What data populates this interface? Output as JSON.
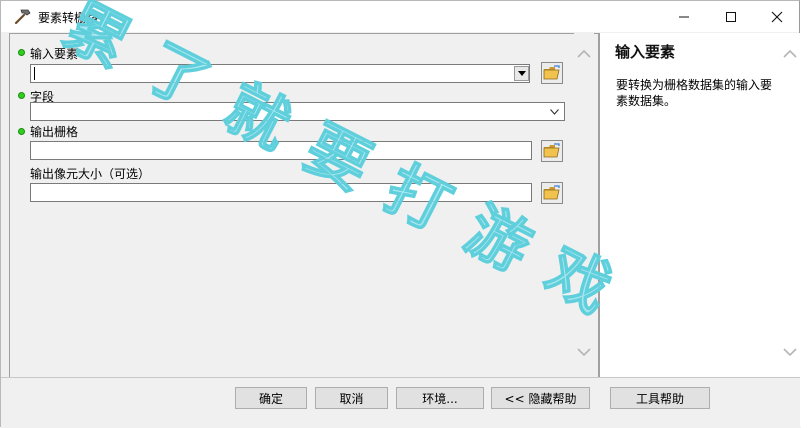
{
  "window": {
    "title": "要素转栅格",
    "minimize_glyph": "—",
    "maximize_glyph": "☐",
    "close_glyph": "✕"
  },
  "form": {
    "input_features_label": "输入要素",
    "input_features_value": "",
    "field_label": "字段",
    "field_value": "",
    "output_raster_label": "输出栅格",
    "output_raster_value": "",
    "cell_size_label": "输出像元大小（可选）",
    "cell_size_value": ""
  },
  "help": {
    "title": "输入要素",
    "body": "要转换为栅格数据集的输入要素数据集。"
  },
  "buttons": {
    "ok": "确定",
    "cancel": "取消",
    "environments": "环境...",
    "hide_help": "<< 隐藏帮助",
    "tool_help": "工具帮助"
  },
  "watermark": {
    "text": "累了就要打游戏",
    "color": "#8fe3ee"
  },
  "colors": {
    "required_dot": "#2fcf1f"
  }
}
